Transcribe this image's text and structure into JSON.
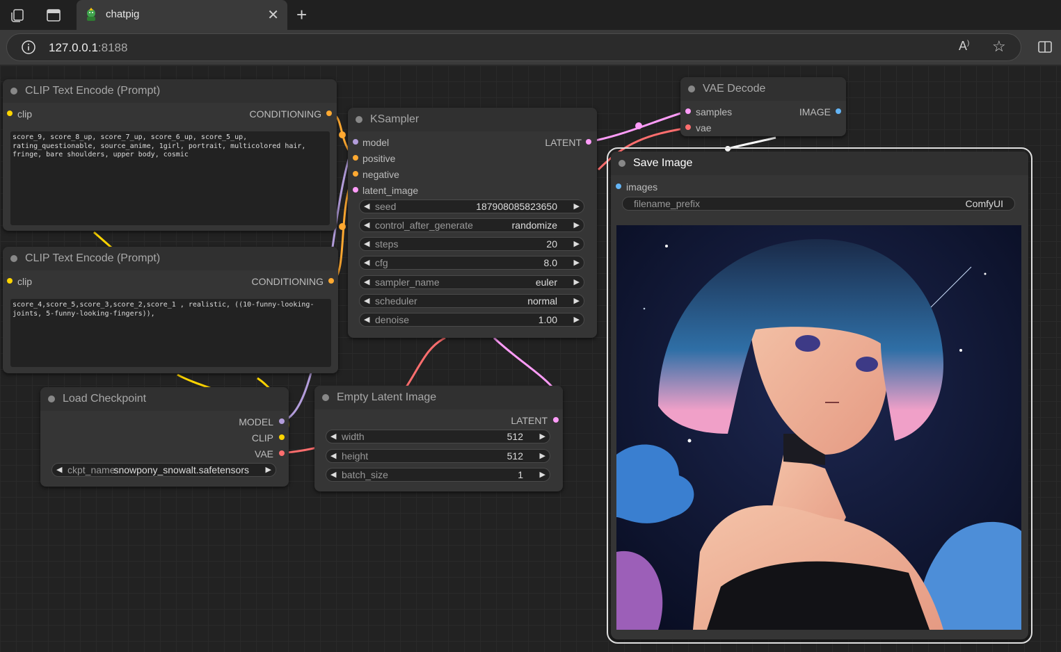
{
  "browser": {
    "tab_title": "chatpig",
    "url_host": "127.0.0.1",
    "url_port": ":8188",
    "icons": [
      "workspaces-icon",
      "tab-actions-icon",
      "chatpig-favicon",
      "close-icon",
      "new-tab-icon",
      "site-info-icon",
      "read-aloud-icon",
      "favorite-star-icon",
      "split-screen-icon"
    ]
  },
  "colors": {
    "clip": "#ffd500",
    "conditioning": "#ffa931",
    "model": "#b39ddb",
    "latent": "#ff9cf9",
    "vae": "#ff6e6e",
    "image": "#64b5f6"
  },
  "nodes": {
    "clip_pos": {
      "title": "CLIP Text Encode (Prompt)",
      "input": "clip",
      "output": "CONDITIONING",
      "text": "score_9, score_8_up, score_7_up, score_6_up, score_5_up, rating_questionable, source_anime, 1girl, portrait, multicolored hair, fringe, bare shoulders, upper body, cosmic"
    },
    "clip_neg": {
      "title": "CLIP Text Encode (Prompt)",
      "input": "clip",
      "output": "CONDITIONING",
      "text": "score_4,score_5,score_3,score_2,score_1 , realistic, ((10-funny-looking-joints, 5-funny-looking-fingers)),"
    },
    "ksampler": {
      "title": "KSampler",
      "inputs": [
        "model",
        "positive",
        "negative",
        "latent_image"
      ],
      "output": "LATENT",
      "widgets": [
        {
          "label": "seed",
          "value": "187908085823650"
        },
        {
          "label": "control_after_generate",
          "value": "randomize"
        },
        {
          "label": "steps",
          "value": "20"
        },
        {
          "label": "cfg",
          "value": "8.0"
        },
        {
          "label": "sampler_name",
          "value": "euler"
        },
        {
          "label": "scheduler",
          "value": "normal"
        },
        {
          "label": "denoise",
          "value": "1.00"
        }
      ]
    },
    "vae_decode": {
      "title": "VAE Decode",
      "inputs": [
        "samples",
        "vae"
      ],
      "output": "IMAGE"
    },
    "save_image": {
      "title": "Save Image",
      "input": "images",
      "widget": {
        "label": "filename_prefix",
        "value": "ComfyUI"
      }
    },
    "load_checkpoint": {
      "title": "Load Checkpoint",
      "outputs": [
        "MODEL",
        "CLIP",
        "VAE"
      ],
      "widget": {
        "label": "ckpt_name",
        "value": "snowpony_snowalt.safetensors"
      }
    },
    "empty_latent": {
      "title": "Empty Latent Image",
      "output": "LATENT",
      "widgets": [
        {
          "label": "width",
          "value": "512"
        },
        {
          "label": "height",
          "value": "512"
        },
        {
          "label": "batch_size",
          "value": "1"
        }
      ]
    }
  }
}
